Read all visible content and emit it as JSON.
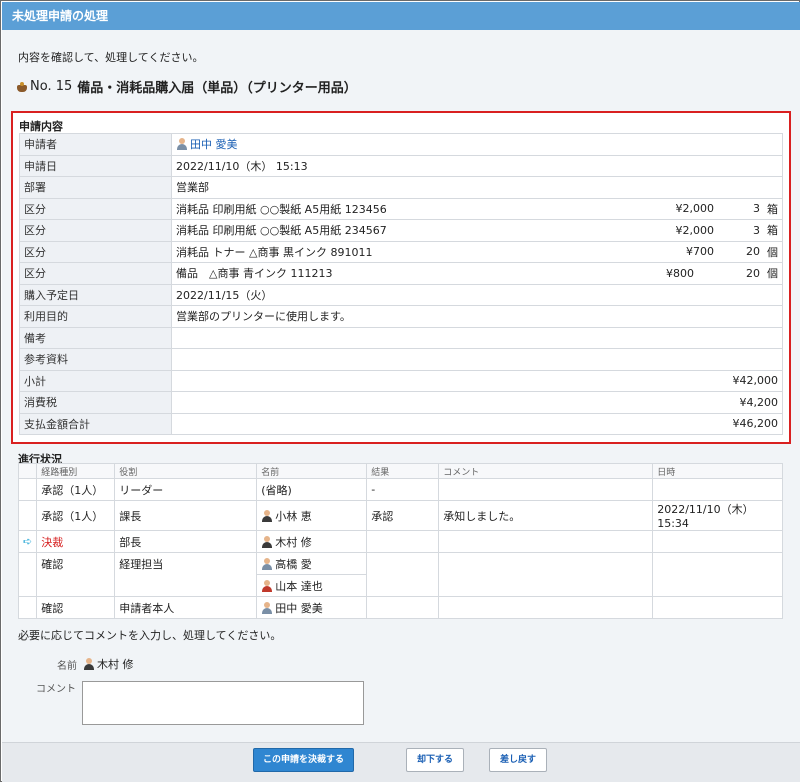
{
  "window": {
    "title": "未処理申請の処理"
  },
  "instruction": "内容を確認して、処理してください。",
  "heading": {
    "number": "No. 15",
    "title": "備品・消耗品購入届（単品）（プリンター用品）",
    "icon": "pot-icon"
  },
  "request": {
    "section_title": "申請内容",
    "applicant": {
      "label": "申請者",
      "value": "田中 愛美"
    },
    "date": {
      "label": "申請日",
      "value": "2022/11/10（木） 15:13"
    },
    "department": {
      "label": "部署",
      "value": "営業部"
    },
    "items": [
      {
        "label": "区分",
        "desc": "消耗品 印刷用紙 ○○製紙 A5用紙 123456",
        "price": "¥2,000",
        "qty": "3",
        "unit": "箱"
      },
      {
        "label": "区分",
        "desc": "消耗品 印刷用紙 ○○製紙 A5用紙 234567",
        "price": "¥2,000",
        "qty": "3",
        "unit": "箱"
      },
      {
        "label": "区分",
        "desc": "消耗品 トナー △商事 黒インク 891011",
        "price": "¥700",
        "qty": "20",
        "unit": "個"
      },
      {
        "label": "区分",
        "desc": "備品　△商事 青インク 111213",
        "price": "¥800",
        "qty": "20",
        "unit": "個"
      }
    ],
    "purchase_date": {
      "label": "購入予定日",
      "value": "2022/11/15（火）"
    },
    "purpose": {
      "label": "利用目的",
      "value": "営業部のプリンターに使用します。"
    },
    "notes": {
      "label": "備考",
      "value": ""
    },
    "references": {
      "label": "参考資料",
      "value": ""
    },
    "subtotal": {
      "label": "小計",
      "value": "¥42,000"
    },
    "tax": {
      "label": "消費税",
      "value": "¥4,200"
    },
    "total": {
      "label": "支払金額合計",
      "value": "¥46,200"
    }
  },
  "progress": {
    "section_title": "進行状況",
    "headers": [
      "経路種別",
      "役割",
      "名前",
      "結果",
      "コメント",
      "日時"
    ],
    "rows": [
      {
        "type": "承認（1人）",
        "role": "リーダー",
        "name": "(省略)",
        "result": "-",
        "comment": "",
        "datetime": ""
      },
      {
        "type": "承認（1人）",
        "role": "課長",
        "name": "小林 恵",
        "result": "承認",
        "comment": "承知しました。",
        "datetime": "2022/11/10（木） 15:34"
      },
      {
        "type": "決裁",
        "role": "部長",
        "name": "木村 修",
        "result": "",
        "comment": "",
        "datetime": ""
      },
      {
        "type": "確認",
        "role": "経理担当",
        "name": "高橋 愛",
        "result": "",
        "comment": "",
        "datetime": ""
      },
      {
        "type": "",
        "role": "",
        "name": "山本 達也",
        "result": "",
        "comment": "",
        "datetime": ""
      },
      {
        "type": "確認",
        "role": "申請者本人",
        "name": "田中 愛美",
        "result": "",
        "comment": "",
        "datetime": ""
      }
    ]
  },
  "action": {
    "prompt": "必要に応じてコメントを入力し、処理してください。",
    "name_label": "名前",
    "name_value": "木村 修",
    "comment_label": "コメント",
    "comment_value": ""
  },
  "buttons": {
    "approve": "この申請を決裁する",
    "reject": "却下する",
    "return": "差し戻す"
  },
  "colors": {
    "title_bar": "#5b9fd6",
    "highlight_border": "#d92020",
    "primary_button": "#2f86d1",
    "link": "#1a5fb4"
  }
}
